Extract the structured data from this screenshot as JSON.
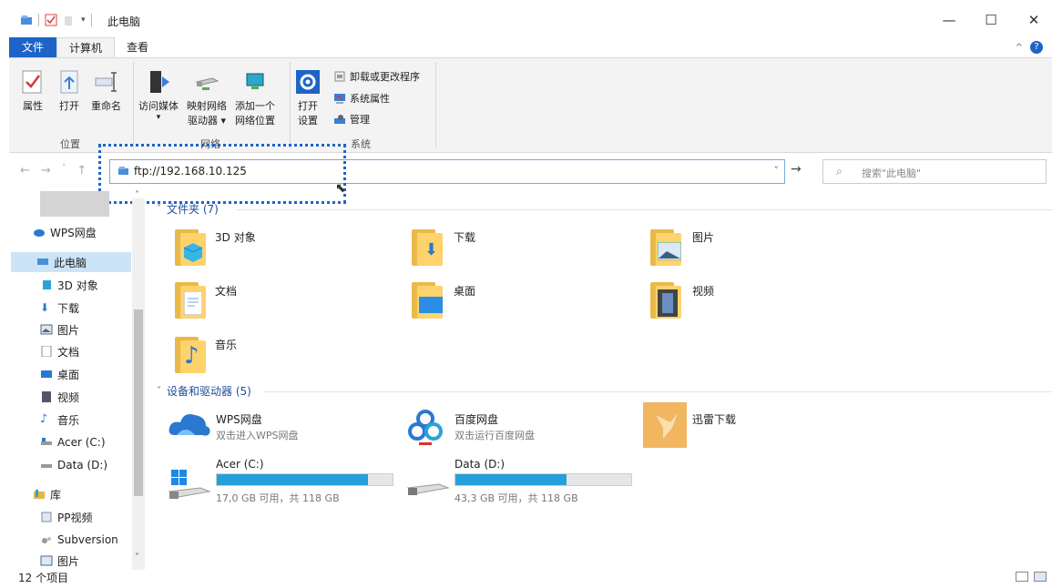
{
  "window": {
    "title": "此电脑",
    "minimize": "—",
    "maximize": "☐",
    "close": "✕"
  },
  "ribbon_tabs": [
    "文件",
    "计算机",
    "查看"
  ],
  "ribbon": {
    "group_location": {
      "label": "位置",
      "buttons": [
        "属性",
        "打开",
        "重命名"
      ]
    },
    "group_network": {
      "label": "网络",
      "buttons": [
        {
          "line1": "访问媒体",
          "line2": ""
        },
        {
          "line1": "映射网络",
          "line2": "驱动器 ▾"
        },
        {
          "line1": "添加一个",
          "line2": "网络位置"
        }
      ]
    },
    "group_system": {
      "label": "系统",
      "open_settings_line1": "打开",
      "open_settings_line2": "设置",
      "small_buttons": [
        "卸载或更改程序",
        "系统属性",
        "管理"
      ]
    }
  },
  "address": {
    "path": "ftp://192.168.10.125",
    "search_placeholder": "搜索\"此电脑\""
  },
  "nav": {
    "items": [
      {
        "label": "WPS网盘",
        "icon": "cloud-icon"
      },
      {
        "label": "此电脑",
        "icon": "computer-icon",
        "selected": true
      },
      {
        "label": "3D 对象",
        "icon": "cube-icon"
      },
      {
        "label": "下载",
        "icon": "download-arrow-icon"
      },
      {
        "label": "图片",
        "icon": "picture-icon"
      },
      {
        "label": "文档",
        "icon": "document-icon"
      },
      {
        "label": "桌面",
        "icon": "desktop-icon"
      },
      {
        "label": "视频",
        "icon": "film-icon"
      },
      {
        "label": "音乐",
        "icon": "music-note-icon"
      },
      {
        "label": "Acer (C:)",
        "icon": "drive-icon"
      },
      {
        "label": "Data (D:)",
        "icon": "drive-icon"
      },
      {
        "label": "库",
        "icon": "library-icon"
      },
      {
        "label": "PP视频",
        "icon": "pp-video-icon"
      },
      {
        "label": "Subversion",
        "icon": "subversion-icon"
      },
      {
        "label": "图片",
        "icon": "picture-icon"
      }
    ]
  },
  "main": {
    "folders_header": "文件夹 (7)",
    "folders": [
      "3D 对象",
      "下载",
      "图片",
      "文档",
      "桌面",
      "视频",
      "音乐"
    ],
    "devices_header": "设备和驱动器 (5)",
    "devices": [
      {
        "name": "WPS网盘",
        "sub": "双击进入WPS网盘"
      },
      {
        "name": "百度网盘",
        "sub": "双击运行百度网盘"
      },
      {
        "name": "迅雷下载",
        "sub": ""
      }
    ],
    "drives": [
      {
        "name": "Acer (C:)",
        "free": "17,0 GB 可用，共 118 GB",
        "used_fraction": 0.86
      },
      {
        "name": "Data (D:)",
        "free": "43,3 GB 可用，共 118 GB",
        "used_fraction": 0.63
      }
    ]
  },
  "status": {
    "count": "12 个项目"
  },
  "colors": {
    "accent": "#1e64c8",
    "drive_bar": "#26a0da",
    "folder": "#ffd36b"
  }
}
